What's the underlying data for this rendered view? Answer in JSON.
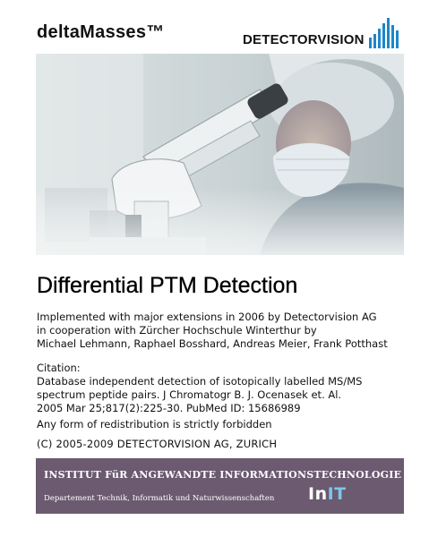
{
  "header": {
    "product_name": "deltaMasses™",
    "company_logo_text": "DETECTORVISION"
  },
  "title": "Differential PTM Detection",
  "implementation": [
    "Implemented with major extensions in 2006 by Detectorvision AG",
    "in cooperation with Zürcher Hochschule Winterthur by",
    "Michael Lehmann, Raphael Bosshard, Andreas Meier, Frank Potthast"
  ],
  "citation": {
    "heading": "Citation:",
    "lines": [
      "Database independent detection of isotopically labelled MS/MS",
      "spectrum peptide pairs. J Chromatogr B. J. Ocenasek et. Al.",
      "2005 Mar 25;817(2):225-30. PubMed ID: 15686989"
    ]
  },
  "redistribution_notice": "Any form of redistribution is strictly forbidden",
  "copyright": "(C) 2005-2009 DETECTORVISION AG, ZURICH",
  "footer": {
    "institute": "INSTITUT FüR ANGEWANDTE INFORMATIONSTECHNOLOGIE",
    "department": "Departement Technik, Informatik und Naturwissenschaften",
    "logo_part1": "In",
    "logo_part2": "IT",
    "logo_accent_color": "#7ec6e6",
    "background_color": "#6b5a70"
  },
  "brand_accent_color": "#1f86c9"
}
